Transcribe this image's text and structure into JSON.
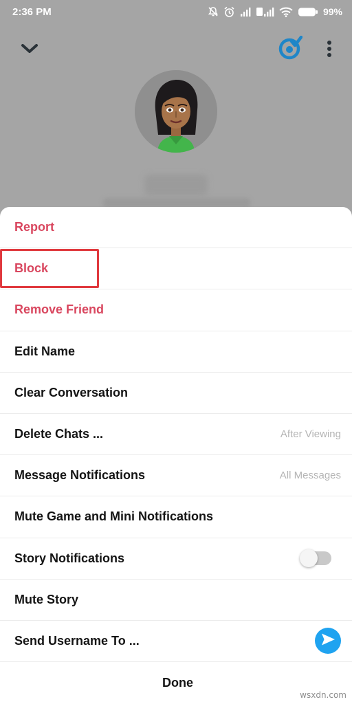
{
  "status_bar": {
    "time": "2:36 PM",
    "battery": "99%",
    "icons": [
      "notifications-off-icon",
      "alarm-icon",
      "signal-icon",
      "volte-signal-icon",
      "wifi-icon",
      "battery-icon"
    ]
  },
  "header": {
    "icons": [
      "chevron-down-icon",
      "bitmoji-icon",
      "more-vertical-icon"
    ],
    "accent": "#1fa3f0"
  },
  "menu": {
    "report": "Report",
    "block": "Block",
    "remove_friend": "Remove Friend",
    "edit_name": "Edit Name",
    "clear_conversation": "Clear Conversation",
    "delete_chats": "Delete Chats ...",
    "delete_chats_value": "After Viewing",
    "message_notifications": "Message Notifications",
    "message_notifications_value": "All Messages",
    "mute_game": "Mute Game and Mini Notifications",
    "story_notifications": "Story Notifications",
    "story_notifications_on": false,
    "mute_story": "Mute Story",
    "send_username": "Send Username To ...",
    "done": "Done",
    "danger_color": "#d9475f"
  },
  "annotation": {
    "highlight_color": "#e0393e"
  },
  "watermark": "wsxdn.com"
}
